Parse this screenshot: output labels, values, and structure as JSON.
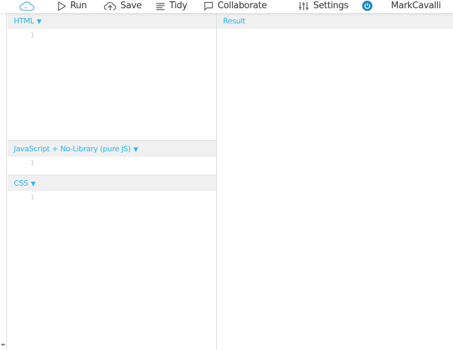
{
  "toolbar": {
    "logo": "cloud-logo-icon",
    "run": "Run",
    "save": "Save",
    "tidy": "Tidy",
    "collaborate": "Collaborate",
    "settings": "Settings",
    "user": "MarkCavalli"
  },
  "panels": {
    "html": {
      "title": "HTML",
      "line": "1"
    },
    "js": {
      "title": "JavaScript + No-Library (pure JS)",
      "line": "1"
    },
    "css": {
      "title": "CSS",
      "line": "1"
    },
    "result": {
      "title": "Result"
    }
  },
  "arrow": "▼",
  "collapse": "◂▸",
  "colors": {
    "accent": "#29b6f6",
    "header_bg": "#f0f0f0",
    "power": "#1e88c8"
  }
}
